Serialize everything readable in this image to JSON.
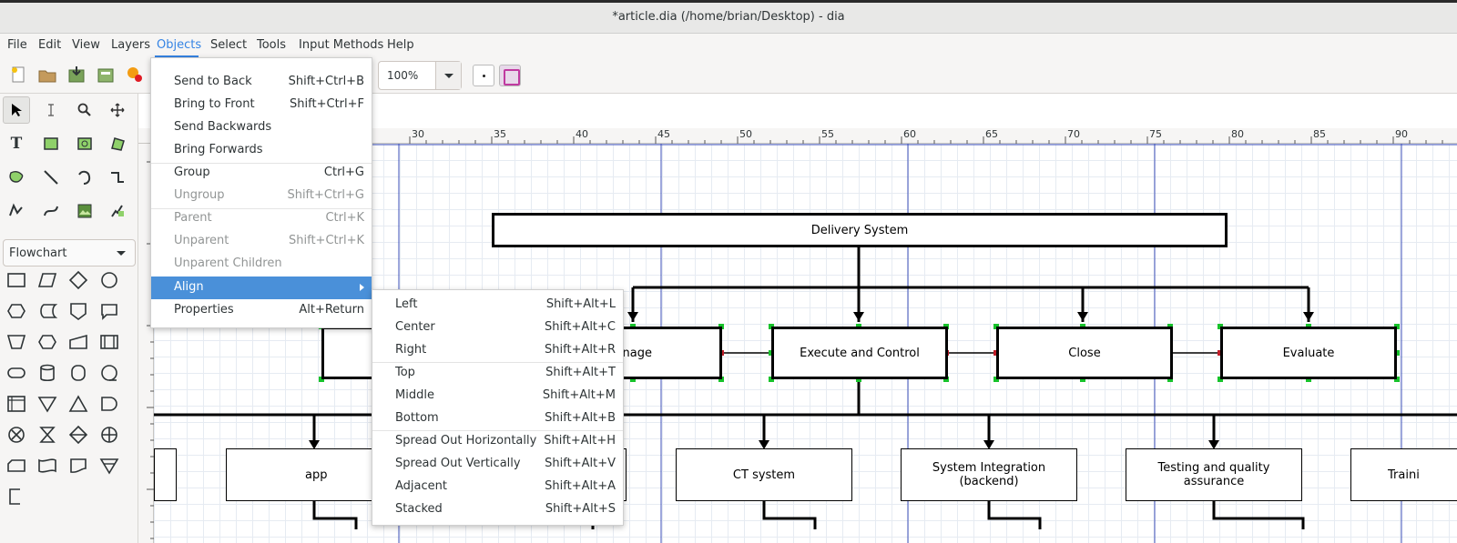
{
  "window": {
    "title": "*article.dia (/home/brian/Desktop) - dia"
  },
  "menubar": {
    "items": [
      "File",
      "Edit",
      "View",
      "Layers",
      "Objects",
      "Select",
      "Tools",
      "Input Methods",
      "Help"
    ],
    "active": "Objects"
  },
  "toolbar": {
    "zoom_value": "100%"
  },
  "toolbox": {
    "sheet": "Flowchart"
  },
  "ruler": {
    "top": [
      "30",
      "35",
      "40",
      "45",
      "50",
      "55",
      "60",
      "65",
      "70",
      "75",
      "80",
      "85",
      "90"
    ]
  },
  "diagram": {
    "top_box": "Delivery System",
    "phase_boxes": [
      "Manage",
      "Execute and Control",
      "Close",
      "Evaluate"
    ],
    "bottom_boxes": [
      "app",
      "CT system",
      "System Integration (backend)",
      "Testing and quality assurance",
      "Traini"
    ]
  },
  "objects_menu": {
    "items": [
      {
        "label": "Send to Back",
        "shortcut": "Shift+Ctrl+B"
      },
      {
        "label": "Bring to Front",
        "shortcut": "Shift+Ctrl+F"
      },
      {
        "label": "Send Backwards",
        "shortcut": ""
      },
      {
        "label": "Bring Forwards",
        "shortcut": ""
      },
      {
        "label": "Group",
        "shortcut": "Ctrl+G"
      },
      {
        "label": "Ungroup",
        "shortcut": "Shift+Ctrl+G"
      },
      {
        "label": "Parent",
        "shortcut": "Ctrl+K"
      },
      {
        "label": "Unparent",
        "shortcut": "Shift+Ctrl+K"
      },
      {
        "label": "Unparent Children",
        "shortcut": ""
      },
      {
        "label": "Align",
        "shortcut": ""
      },
      {
        "label": "Properties",
        "shortcut": "Alt+Return"
      }
    ]
  },
  "align_menu": {
    "items": [
      {
        "label": "Left",
        "shortcut": "Shift+Alt+L"
      },
      {
        "label": "Center",
        "shortcut": "Shift+Alt+C"
      },
      {
        "label": "Right",
        "shortcut": "Shift+Alt+R"
      },
      {
        "label": "Top",
        "shortcut": "Shift+Alt+T"
      },
      {
        "label": "Middle",
        "shortcut": "Shift+Alt+M"
      },
      {
        "label": "Bottom",
        "shortcut": "Shift+Alt+B"
      },
      {
        "label": "Spread Out Horizontally",
        "shortcut": "Shift+Alt+H"
      },
      {
        "label": "Spread Out Vertically",
        "shortcut": "Shift+Alt+V"
      },
      {
        "label": "Adjacent",
        "shortcut": "Shift+Alt+A"
      },
      {
        "label": "Stacked",
        "shortcut": "Shift+Alt+S"
      }
    ]
  },
  "colors": {
    "accent": "#4a90d9",
    "menu_active_text": "#3584e4"
  }
}
